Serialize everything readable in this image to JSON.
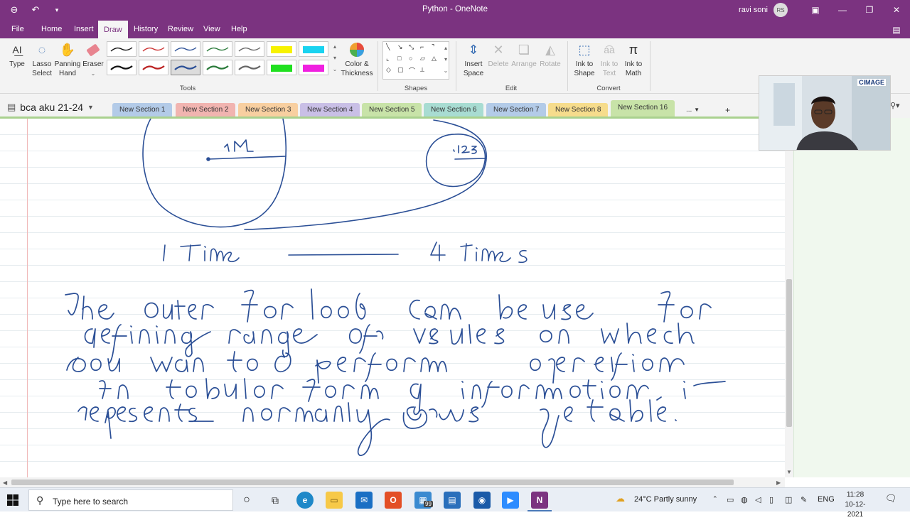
{
  "window": {
    "title": "Python - OneNote",
    "user_name": "ravi soni",
    "user_initials": "RS",
    "accent_color": "#7b3380"
  },
  "menu": {
    "items": [
      "File",
      "Home",
      "Insert",
      "Draw",
      "History",
      "Review",
      "View",
      "Help"
    ],
    "active": "Draw"
  },
  "ribbon": {
    "type_label": "Type",
    "lasso_label_1": "Lasso",
    "lasso_label_2": "Select",
    "panning_label_1": "Panning",
    "panning_label_2": "Hand",
    "eraser_label": "Eraser",
    "color_label_1": "Color &",
    "color_label_2": "Thickness",
    "tools_group": "Tools",
    "shapes_group": "Shapes",
    "insert_space_1": "Insert",
    "insert_space_2": "Space",
    "delete_label": "Delete",
    "arrange_label": "Arrange",
    "rotate_label": "Rotate",
    "edit_group": "Edit",
    "ink_shape_1": "Ink to",
    "ink_shape_2": "Shape",
    "ink_text_1": "Ink to",
    "ink_text_2": "Text",
    "ink_math_1": "Ink to",
    "ink_math_2": "Math",
    "convert_group": "Convert"
  },
  "notebook": {
    "name": "bca aku 21-24",
    "sections": [
      {
        "label": "New Section 1",
        "color": "#b3cbe8"
      },
      {
        "label": "New Section 2",
        "color": "#f1b4b0"
      },
      {
        "label": "New Section 3",
        "color": "#f8cfa0"
      },
      {
        "label": "New Section 4",
        "color": "#c9bfe6"
      },
      {
        "label": "New Section 5",
        "color": "#c8e3a8"
      },
      {
        "label": "New Section 6",
        "color": "#a8dcd2"
      },
      {
        "label": "New Section 7",
        "color": "#b3cbe8"
      },
      {
        "label": "New Section 8",
        "color": "#f6dc8c"
      },
      {
        "label": "New Section 16",
        "color": "#c8e3a8"
      }
    ],
    "more_label": "...",
    "add_label": "+"
  },
  "webcam": {
    "logo": "CIMAGE"
  },
  "taskbar": {
    "search_placeholder": "Type here to search",
    "badge_count": "99",
    "weather": "24°C  Partly sunny",
    "language": "ENG",
    "time": "11:28",
    "date": "10-12-2021"
  },
  "ink": {
    "color": "#2b4f96"
  }
}
